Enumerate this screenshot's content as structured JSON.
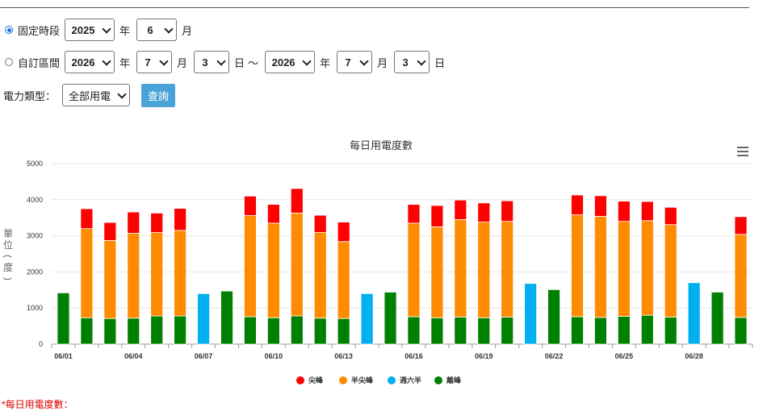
{
  "filters": {
    "fixed_period_label": "固定時段",
    "fixed_year": "2025",
    "year_unit": "年",
    "fixed_month": "6",
    "month_unit": "月",
    "custom_range_label": "自訂區間",
    "start_year": "2026",
    "start_month": "7",
    "start_day": "3",
    "day_unit": "日",
    "range_sep": "～",
    "end_year": "2026",
    "end_month": "7",
    "end_day": "3",
    "power_type_label": "電力類型：",
    "power_type_value": "全部用電",
    "query_button": "查詢"
  },
  "chart_data": {
    "type": "bar",
    "stacked": true,
    "title": "每日用電度數",
    "ylabel": "單位(度)",
    "ylim": [
      0,
      5000
    ],
    "yticks": [
      0,
      1000,
      2000,
      3000,
      4000,
      5000
    ],
    "xtick_labels": [
      "06/01",
      "06/04",
      "06/07",
      "06/10",
      "06/13",
      "06/16",
      "06/19",
      "06/22",
      "06/25",
      "06/28"
    ],
    "grid": true,
    "legend_position": "bottom",
    "days": [
      "06/01",
      "06/02",
      "06/03",
      "06/04",
      "06/05",
      "06/06",
      "06/07",
      "06/08",
      "06/09",
      "06/10",
      "06/11",
      "06/12",
      "06/13",
      "06/14",
      "06/15",
      "06/16",
      "06/17",
      "06/18",
      "06/19",
      "06/20",
      "06/21",
      "06/22",
      "06/23",
      "06/24",
      "06/25",
      "06/26",
      "06/27",
      "06/28",
      "06/29",
      "06/30"
    ],
    "series": [
      {
        "name": "離峰",
        "color": "#008000",
        "values": [
          1420,
          730,
          710,
          720,
          780,
          780,
          0,
          1470,
          760,
          730,
          780,
          720,
          710,
          0,
          1440,
          760,
          730,
          750,
          730,
          750,
          0,
          1510,
          760,
          740,
          770,
          800,
          750,
          0,
          1440,
          740
        ]
      },
      {
        "name": "週六半",
        "color": "#00b0f0",
        "values": [
          0,
          0,
          0,
          0,
          0,
          0,
          1400,
          0,
          0,
          0,
          0,
          0,
          0,
          1400,
          0,
          0,
          0,
          0,
          0,
          0,
          1680,
          0,
          0,
          0,
          0,
          0,
          0,
          1700,
          0,
          0
        ]
      },
      {
        "name": "半尖峰",
        "color": "#ff8c00",
        "values": [
          0,
          2470,
          2160,
          2350,
          2310,
          2370,
          0,
          0,
          2800,
          2620,
          2850,
          2370,
          2130,
          0,
          0,
          2590,
          2520,
          2700,
          2650,
          2650,
          0,
          0,
          2820,
          2800,
          2630,
          2620,
          2560,
          0,
          0,
          2300
        ]
      },
      {
        "name": "尖峰",
        "color": "#ff0000",
        "values": [
          0,
          550,
          500,
          590,
          540,
          610,
          0,
          0,
          540,
          520,
          680,
          480,
          540,
          0,
          0,
          520,
          590,
          540,
          530,
          570,
          0,
          0,
          550,
          570,
          560,
          530,
          480,
          0,
          0,
          490
        ]
      }
    ],
    "legend_order": [
      "尖峰",
      "半尖峰",
      "週六半",
      "離峰"
    ],
    "weekend_bar_note": "",
    "footnote": "*每日用電度數："
  }
}
